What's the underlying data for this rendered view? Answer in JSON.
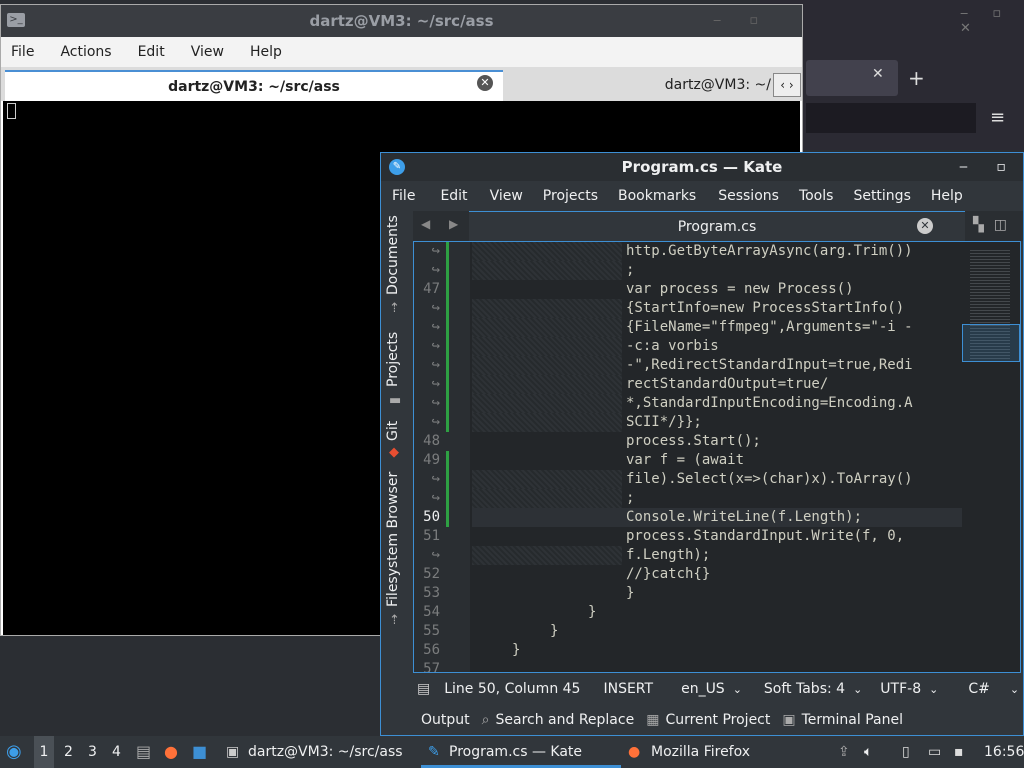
{
  "firefox_bg": {
    "tab_close": "✕",
    "new_tab": "+",
    "menu_icon": "≡",
    "window_controls": "‒ ▫ ✕"
  },
  "konsole": {
    "title": "dartz@VM3: ~/src/ass",
    "window_controls": "‒ ▫ ✕",
    "menu": [
      "File",
      "Actions",
      "Edit",
      "View",
      "Help"
    ],
    "tab1": "dartz@VM3: ~/src/ass",
    "tab2": "dartz@VM3: ~/",
    "tab_arrows": "‹ ›"
  },
  "kate": {
    "title": "Program.cs  — Kate",
    "window_controls": "‒ ▫ ✕",
    "menu": [
      "File",
      "Edit",
      "View",
      "Projects",
      "Bookmarks",
      "Sessions",
      "Tools",
      "Settings",
      "Help"
    ],
    "side_tabs": [
      "Documents",
      "Projects",
      "Git",
      "Filesystem Browser"
    ],
    "doc_tab": "Program.cs",
    "line_numbers": [
      "↪",
      "↪",
      "47",
      "↪",
      "↪",
      "↪",
      "↪",
      "↪",
      "↪",
      "↪",
      "48",
      "49",
      "↪",
      "↪",
      "50",
      "51",
      "↪",
      "52",
      "53",
      "54",
      "55",
      "56",
      "57"
    ],
    "code_lines": [
      "http.GetByteArrayAsync(arg.Trim())",
      ";",
      "var process = new Process()",
      "{StartInfo=new ProcessStartInfo()",
      "{FileName=\"ffmpeg\",Arguments=\"-i -",
      "-c:a vorbis",
      "-\",RedirectStandardInput=true,Redi",
      "rectStandardOutput=true/",
      "*,StandardInputEncoding=Encoding.A",
      "SCII*/}};",
      "process.Start();",
      "var f = (await",
      "file).Select(x=>(char)x).ToArray()",
      ";",
      "Console.WriteLine(f.Length);",
      "process.StandardInput.Write(f, 0,",
      "f.Length);",
      "//}catch{}",
      "}",
      "}",
      "}",
      "}",
      ""
    ],
    "status": {
      "position": "Line 50, Column 45",
      "mode": "INSERT",
      "language": "en_US",
      "indent": "Soft Tabs: 4",
      "encoding": "UTF-8",
      "syntax": "C#"
    },
    "panels": [
      "Output",
      "Search and Replace",
      "Current Project",
      "Terminal Panel"
    ]
  },
  "taskbar": {
    "desktops": [
      "1",
      "2",
      "3",
      "4"
    ],
    "tasks": [
      "dartz@VM3: ~/src/ass",
      "Program.cs  — Kate",
      "Mozilla Firefox"
    ],
    "clock": "16:56"
  }
}
